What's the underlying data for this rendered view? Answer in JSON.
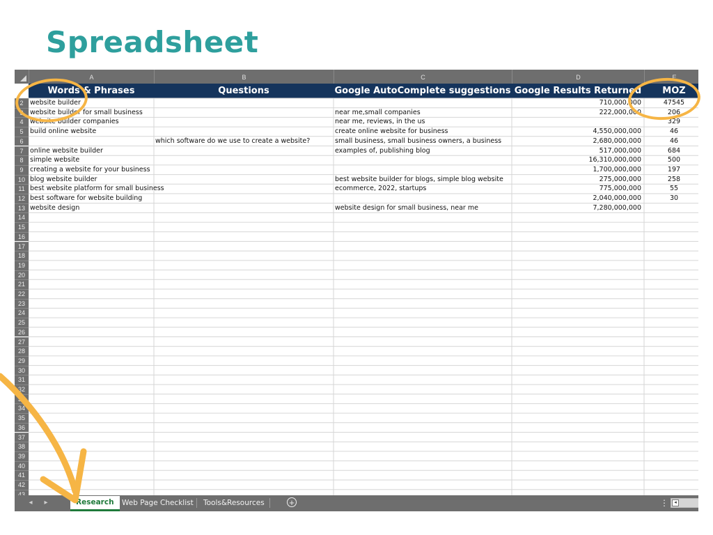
{
  "slide": {
    "title": "Spreadsheet"
  },
  "columns": [
    "A",
    "B",
    "C",
    "D",
    "E"
  ],
  "headers": [
    "Words & Phrases",
    "Questions",
    "Google AutoComplete suggestions",
    "Google Results Returned",
    "MOZ"
  ],
  "row_numbers": [
    "2",
    "3",
    "4",
    "5",
    "6",
    "7",
    "8",
    "9",
    "10",
    "11",
    "12",
    "13",
    "14",
    "15",
    "16",
    "17",
    "18",
    "19",
    "20",
    "21",
    "22",
    "23",
    "24",
    "25",
    "26",
    "27",
    "28",
    "29",
    "30",
    "31",
    "32",
    "33",
    "34",
    "35",
    "36",
    "37",
    "38",
    "39",
    "40",
    "41",
    "42",
    "43"
  ],
  "rows": [
    [
      "website builder",
      "",
      "",
      "710,000,000",
      "47545"
    ],
    [
      "website builder for small business",
      "",
      "near me,small companies",
      "222,000,000",
      "206"
    ],
    [
      "website builder companies",
      "",
      "near me, reviews, in the us",
      "",
      "329"
    ],
    [
      "build online website",
      "",
      "create online website for business",
      "4,550,000,000",
      "46"
    ],
    [
      "",
      "which software do we use to create a website?",
      "small business, small business owners, a business",
      "2,680,000,000",
      "46"
    ],
    [
      "online website builder",
      "",
      "examples of, publishing blog",
      "517,000,000",
      "684"
    ],
    [
      "simple website",
      "",
      "",
      "16,310,000,000",
      "500"
    ],
    [
      "creating a website for your business",
      "",
      "",
      "1,700,000,000",
      "197"
    ],
    [
      "blog website builder",
      "",
      "best website builder for blogs, simple blog website",
      "275,000,000",
      "258"
    ],
    [
      "best website platform for small business",
      "",
      "ecommerce, 2022, startups",
      "775,000,000",
      "55"
    ],
    [
      "best software for website building",
      "",
      "",
      "2,040,000,000",
      "30"
    ],
    [
      "website design",
      "",
      "website design for small business, near me",
      "7,280,000,000",
      ""
    ]
  ],
  "tabs": {
    "prev_icon": "left-arrow-icon",
    "next_icon": "right-arrow-icon",
    "items": [
      "Research",
      "Web Page Checklist",
      "Tools&Resources"
    ],
    "active": "Research",
    "add_icon": "plus-circle-icon"
  },
  "colors": {
    "title": "#2e9f9d",
    "header_bg": "#15345c",
    "accent_annotation": "#f6b545",
    "active_tab": "#1f7a3a"
  }
}
